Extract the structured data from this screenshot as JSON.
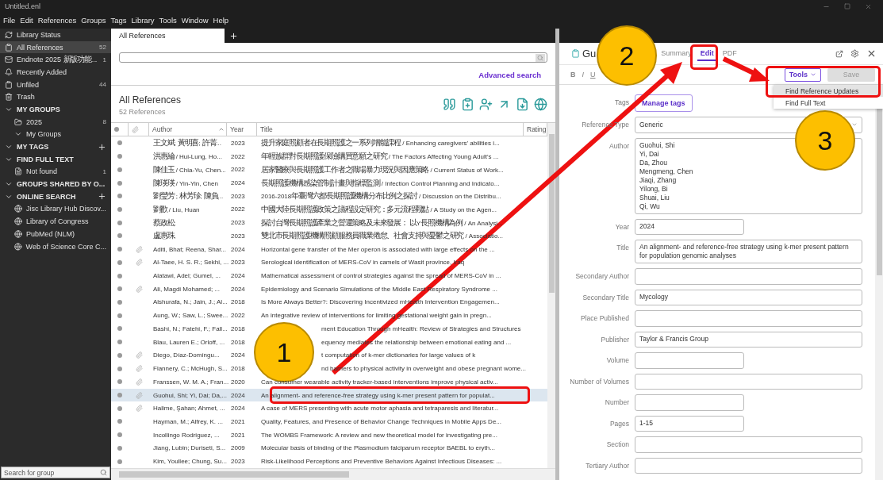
{
  "window": {
    "title": "Untitled.enl"
  },
  "menu": [
    "File",
    "Edit",
    "References",
    "Groups",
    "Tags",
    "Library",
    "Tools",
    "Window",
    "Help"
  ],
  "sidebar": {
    "items": [
      {
        "kind": "item",
        "label": "Library Status",
        "selected": false
      },
      {
        "kind": "item",
        "label": "All References",
        "count": "52",
        "selected": true
      },
      {
        "kind": "item",
        "label": "Endnote 2025 新版功能...",
        "count": "1",
        "selected": false
      },
      {
        "kind": "item",
        "label": "Recently Added",
        "selected": false
      },
      {
        "kind": "item",
        "label": "Unfiled",
        "count": "44",
        "selected": false
      },
      {
        "kind": "item",
        "label": "Trash",
        "selected": false
      },
      {
        "kind": "section",
        "label": "MY GROUPS",
        "expanded": true,
        "add": false,
        "children": [
          {
            "kind": "item",
            "label": "2025",
            "count": "8",
            "selected": false
          },
          {
            "kind": "group",
            "label": "My Groups",
            "expanded": true
          }
        ]
      },
      {
        "kind": "section",
        "label": "MY TAGS",
        "expanded": true,
        "add": true
      },
      {
        "kind": "section",
        "label": "FIND FULL TEXT",
        "expanded": true,
        "add": false,
        "children": [
          {
            "kind": "item",
            "label": "Not found",
            "count": "1",
            "selected": false
          }
        ]
      },
      {
        "kind": "section",
        "label": "GROUPS SHARED BY O...",
        "expanded": true,
        "add": false
      },
      {
        "kind": "section",
        "label": "ONLINE SEARCH",
        "expanded": true,
        "add": true,
        "children": [
          {
            "kind": "item",
            "label": "Jisc Library Hub Discov...",
            "selected": false
          },
          {
            "kind": "item",
            "label": "Library of Congress",
            "selected": false
          },
          {
            "kind": "item",
            "label": "PubMed (NLM)",
            "selected": false
          },
          {
            "kind": "item",
            "label": "Web of Science Core C...",
            "selected": false
          }
        ]
      }
    ],
    "search": {
      "placeholder": "Search for group"
    }
  },
  "library": {
    "tabs": [
      {
        "label": "All References",
        "selected": true
      }
    ],
    "search": {
      "link": "Advanced search"
    },
    "heading": "All References",
    "count": "52 References",
    "table": {
      "columns": [
        "Author",
        "Year",
        "Title",
        "Rating"
      ],
      "rows": [
        {
          "author": "王文斌; 黃明喜; 許菁...",
          "year": "2023",
          "title": "提升家庭照顧者在長期照護之一系列增能課程 / Enhancing caregivers' abilities i...",
          "attachment": false,
          "selected": false,
          "covered": false
        },
        {
          "author": "洪惠綸 / Hui-Lung, Ho...",
          "year": "2022",
          "title": "年輕族群對長期照護保險購買意願之研究 / The Factors Affecting Young Adult's ...",
          "attachment": false,
          "selected": false,
          "covered": false
        },
        {
          "author": "陳佳玉 / Chia-Yu, Chen...",
          "year": "2022",
          "title": "居家醫療與長期照護工作者之職場暴力現況與因應策略 / Current Status of Work...",
          "attachment": false,
          "selected": false,
          "covered": false
        },
        {
          "author": "陳瑛瑛 / Yin-Yin, Chen",
          "year": "2024",
          "title": "長期照護機構感染管制計畫與指標監測 / Infection Control Planning and Indicato...",
          "attachment": false,
          "selected": false,
          "covered": false
        },
        {
          "author": "劉瑩芳 ; 林芳珍; 陳負...",
          "year": "2023",
          "title": "2016-2018年臺灣六都長期照護機構分布比例之探討 / Discussion on the Distribu...",
          "attachment": false,
          "selected": false,
          "covered": false
        },
        {
          "author": "劉歡 / Liu, Huan",
          "year": "2022",
          "title": "中國大陸長期照護政策之議程設定研究：多元流程觀點 / A Study on the Agen...",
          "attachment": false,
          "selected": false,
          "covered": false
        },
        {
          "author": "蔡政松,",
          "year": "2023",
          "title": "探討台灣長期照護產業之營運策略及未來發展： 以Y長照機構為例 / An Analysi...",
          "attachment": false,
          "selected": false,
          "covered": false
        },
        {
          "author": "盧惠珠,",
          "year": "2023",
          "title": "雙北市長期照護機構照顧服務員職業倦怠、社會支持與憂鬱之研究 / Associatio...",
          "attachment": false,
          "selected": false,
          "covered": false
        },
        {
          "author": "Aditi, Bhat; Reena, Shar...",
          "year": "2024",
          "title": "Horizontal gene transfer of the Mer operon is associated with large effects on the ...",
          "attachment": true,
          "selected": false,
          "covered": false
        },
        {
          "author": "Al-Taee, H. S. R.; Sekhi, ...",
          "year": "2023",
          "title": "Serological identification of MERS-CoV in camels of Wasit province, Iraq",
          "attachment": true,
          "selected": false,
          "covered": false
        },
        {
          "author": "Alatawi, Adel; Gumel, ...",
          "year": "2024",
          "title": "Mathematical assessment of control strategies against the spread of MERS-CoV in ...",
          "attachment": false,
          "selected": false,
          "covered": false
        },
        {
          "author": "Ali, Magdi Mohamed; ...",
          "year": "2024",
          "title": "Epidemiology and Scenario Simulations of the Middle East Respiratory Syndrome ...",
          "attachment": true,
          "selected": false,
          "covered": false
        },
        {
          "author": "Alshurafa, N.; Jain, J.; Al...",
          "year": "2018",
          "title": "Is More Always Better?: Discovering Incentivized mHealth Intervention Engagemen...",
          "attachment": false,
          "selected": false,
          "covered": false
        },
        {
          "author": "Aung, W.; Saw, L.; Swee...",
          "year": "2022",
          "title": "An integrative review of interventions for limiting gestational weight gain in pregn...",
          "attachment": false,
          "selected": false,
          "covered": false
        },
        {
          "author": "Bashi, N.; Fatehi, F.; Fall...",
          "year": "2018",
          "title": "ment Education Through mHealth: Review of Strategies and Structures",
          "attachment": false,
          "selected": false,
          "covered": true
        },
        {
          "author": "Blau, Lauren E.; Orloff, ...",
          "year": "2018",
          "title": "equency mediates the relationship between emotional eating and ...",
          "attachment": false,
          "selected": false,
          "covered": true
        },
        {
          "author": "Diego, Díaz-Domíngu...",
          "year": "2024",
          "title": "t computation of k-mer dictionaries for large values of k",
          "attachment": true,
          "selected": false,
          "covered": true
        },
        {
          "author": "Flannery, C.; McHugh, S...",
          "year": "2018",
          "title": "nd barriers to physical activity in overweight and obese pregnant wome...",
          "attachment": true,
          "selected": false,
          "covered": true
        },
        {
          "author": "Franssen, W. M. A.; Fran...",
          "year": "2020",
          "title": "Can consumer wearable activity tracker-based interventions improve physical activ...",
          "attachment": true,
          "selected": false,
          "covered": false
        },
        {
          "author": "Guohui, Shi; Yi, Dai; Da,...",
          "year": "2024",
          "title": "An alignment- and reference-free strategy using k-mer present pattern for populat...",
          "attachment": true,
          "selected": true,
          "covered": false
        },
        {
          "author": "Halime, Şahan; Ahmet, ...",
          "year": "2024",
          "title": "A case of MERS presenting with acute motor aphasia and tetraparesis and literatur...",
          "attachment": true,
          "selected": false,
          "covered": false
        },
        {
          "author": "Hayman, M.; Alfrey, K. ...",
          "year": "2021",
          "title": "Quality, Features, and Presence of Behavior Change Techniques in Mobile Apps De...",
          "attachment": false,
          "selected": false,
          "covered": false
        },
        {
          "author": "Incollingo Rodriguez, ...",
          "year": "2021",
          "title": "The WOMBS Framework: A review and new theoretical model for investigating pre...",
          "attachment": false,
          "selected": false,
          "covered": false
        },
        {
          "author": "Jiang, Lubin; Duriseti, S...",
          "year": "2009",
          "title": "Molecular basis of binding of the Plasmodium falciparum receptor BAEBL to eryth...",
          "attachment": false,
          "selected": false,
          "covered": false
        },
        {
          "author": "Kim, Youllee; Chung, Su...",
          "year": "2023",
          "title": "Risk-Likelihood Perceptions and Preventive Behaviors Against Infectious Diseases: ...",
          "attachment": false,
          "selected": false,
          "covered": false
        }
      ]
    }
  },
  "editor": {
    "title": "Gu",
    "tabs": [
      {
        "label": "Summary",
        "selected": false
      },
      {
        "label": "Edit",
        "selected": true
      },
      {
        "label": "PDF",
        "selected": false
      }
    ],
    "format": [
      "B",
      "I",
      "U"
    ],
    "tools": "Tools",
    "save": {
      "label": "Save",
      "disabled": true
    },
    "menu": [
      {
        "label": "Find Reference Updates",
        "selected": true
      },
      {
        "label": "Find Full Text",
        "selected": false
      }
    ],
    "fields": [
      {
        "kind": "tags",
        "label": "Tags",
        "value": "Manage tags"
      },
      {
        "kind": "select",
        "label": "Reference Type",
        "value": "Generic"
      },
      {
        "kind": "lines",
        "label": "Author",
        "lines": [
          "Guohui, Shi",
          "Yi, Dai",
          "Da, Zhou",
          "Mengmeng, Chen",
          "Jiaqi, Zhang",
          "Yilong, Bi",
          "Shuai, Liu",
          "Qi, Wu"
        ]
      },
      {
        "kind": "short",
        "label": "Year",
        "value": "2024"
      },
      {
        "kind": "text",
        "label": "Title",
        "value": "An alignment- and reference-free strategy using k-mer present pattern for population genomic analyses"
      },
      {
        "kind": "text",
        "label": "Secondary Author"
      },
      {
        "kind": "text",
        "label": "Secondary Title",
        "value": "Mycology"
      },
      {
        "kind": "text",
        "label": "Place Published"
      },
      {
        "kind": "text",
        "label": "Publisher",
        "value": "Taylor & Francis Group"
      },
      {
        "kind": "short",
        "label": "Volume"
      },
      {
        "kind": "text",
        "label": "Number of Volumes"
      },
      {
        "kind": "short",
        "label": "Number"
      },
      {
        "kind": "short",
        "label": "Pages",
        "value": "1-15"
      },
      {
        "kind": "text",
        "label": "Section"
      },
      {
        "kind": "text",
        "label": "Tertiary Author"
      }
    ]
  },
  "annotations": [
    {
      "label": "1"
    },
    {
      "label": "2"
    },
    {
      "label": "3"
    }
  ]
}
